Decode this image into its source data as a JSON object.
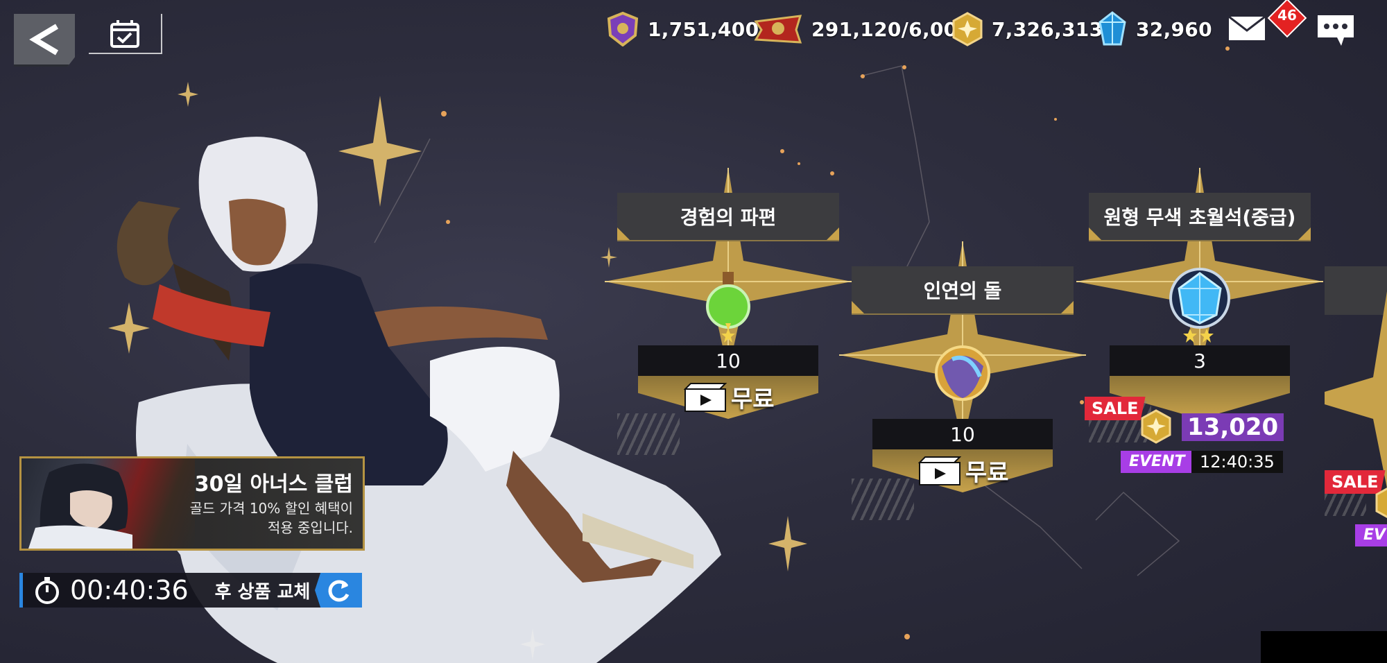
{
  "top_bar": {
    "resources": [
      {
        "icon": "purple-crest-icon",
        "value": "1,751,400"
      },
      {
        "icon": "red-banner-icon",
        "value": "291,120/6,000"
      },
      {
        "icon": "gold-coin-icon",
        "value": "7,326,313"
      },
      {
        "icon": "blue-crystal-icon",
        "value": "32,960"
      }
    ],
    "mail_badge": "46"
  },
  "promo": {
    "title": "30일 아너스 클럽",
    "desc_line1": "골드 가격 10% 할인 혜택이",
    "desc_line2": "적용 중입니다."
  },
  "timer": {
    "value": "00:40:36",
    "suffix": "후 상품 교체"
  },
  "items": [
    {
      "name": "경험의 파편",
      "qty": "10",
      "price_label": "무료",
      "stars": 1
    },
    {
      "name": "인연의 돌",
      "qty": "10",
      "price_label": "무료"
    },
    {
      "name": "원형 무색 초월석(중급)",
      "qty": "3",
      "sale": "SALE",
      "price": "13,020",
      "event": "EVENT",
      "event_time": "12:40:35",
      "stars": 2
    }
  ],
  "partial_item": {
    "sale": "SALE",
    "event": "EV"
  },
  "colors": {
    "accent_gold": "#c8a24a",
    "sale_red": "#e2283a",
    "event_purple": "#a83ee6",
    "refresh_blue": "#2a86e0"
  }
}
